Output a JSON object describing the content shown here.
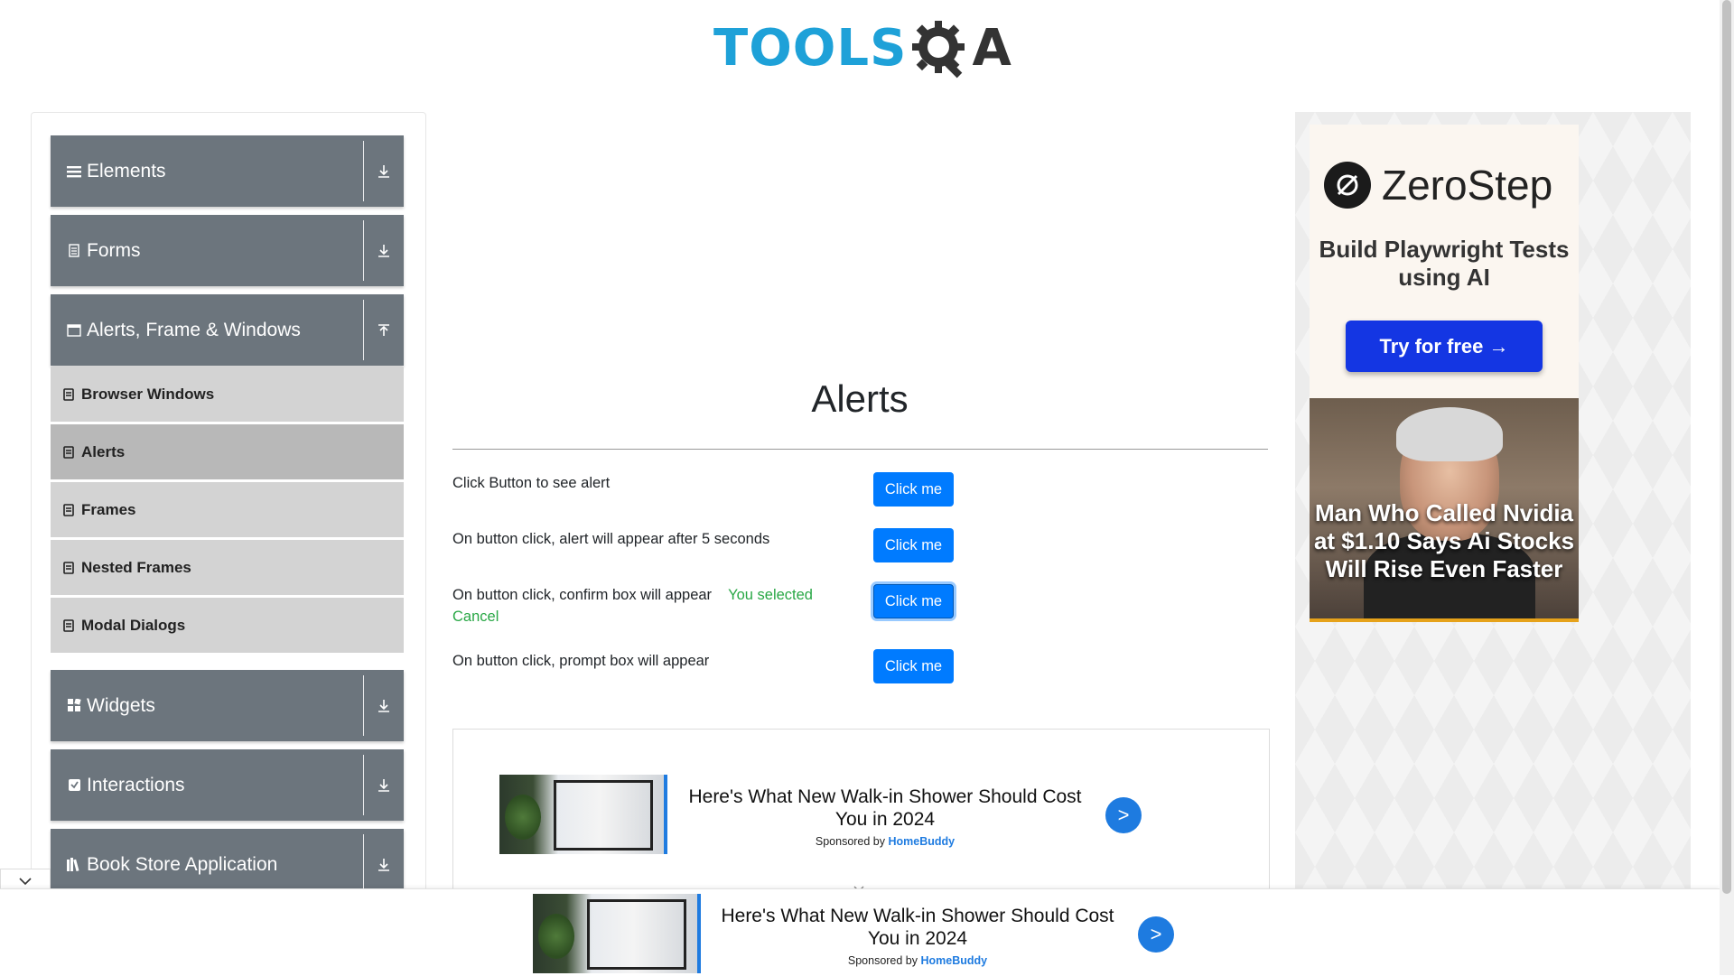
{
  "header": {
    "logo_tools": "TOOLS",
    "logo_a": "A"
  },
  "sidebar": {
    "groups": [
      {
        "label": "Elements",
        "icon": "list-icon",
        "expanded": false
      },
      {
        "label": "Forms",
        "icon": "form-icon",
        "expanded": false
      },
      {
        "label": "Alerts, Frame & Windows",
        "icon": "window-icon",
        "expanded": true
      },
      {
        "label": "Widgets",
        "icon": "widgets-icon",
        "expanded": false
      },
      {
        "label": "Interactions",
        "icon": "interactions-icon",
        "expanded": false
      },
      {
        "label": "Book Store Application",
        "icon": "books-icon",
        "expanded": false
      }
    ],
    "items": [
      {
        "label": "Browser Windows",
        "active": false
      },
      {
        "label": "Alerts",
        "active": true
      },
      {
        "label": "Frames",
        "active": false
      },
      {
        "label": "Nested Frames",
        "active": false
      },
      {
        "label": "Modal Dialogs",
        "active": false
      }
    ]
  },
  "main": {
    "title": "Alerts",
    "rows": [
      {
        "label": "Click Button to see alert",
        "button": "Click me"
      },
      {
        "label": "On button click, alert will appear after 5 seconds",
        "button": "Click me"
      },
      {
        "label": "On button click, confirm box will appear",
        "result": "You selected Cancel",
        "button": "Click me"
      },
      {
        "label": "On button click, prompt box will appear",
        "button": "Click me"
      }
    ]
  },
  "ads": {
    "inline": {
      "headline": "Here's What New Walk-in Shower Should Cost You in 2024",
      "sponsored_prefix": "Sponsored by",
      "sponsor": "HomeBuddy",
      "go": ">"
    },
    "sticky": {
      "headline": "Here's What New Walk-in Shower Should Cost You in 2024",
      "sponsored_prefix": "Sponsored by",
      "sponsor": "HomeBuddy",
      "go": ">"
    },
    "right": {
      "brand": "ZeroStep",
      "tagline": "Build Playwright Tests using AI",
      "cta": "Try for free →",
      "news_headline": "Man Who Called Nvidia at $1.10 Says Ai Stocks Will Rise Even Faster"
    }
  },
  "colors": {
    "sidebar_header": "#6c757d",
    "sidebar_item": "#d3d3d3",
    "sidebar_item_active": "#b8b8b8",
    "primary_button": "#007bff",
    "success_text": "#28a745",
    "logo_blue": "#1ea1d8"
  }
}
